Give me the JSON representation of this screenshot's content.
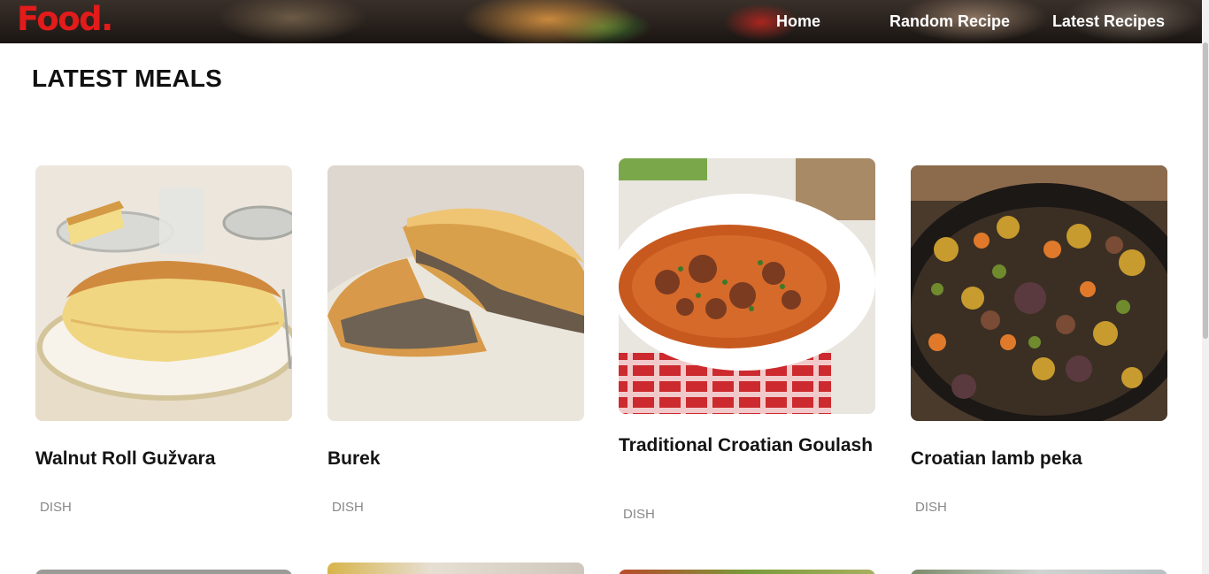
{
  "header": {
    "logo": "Food.",
    "nav": [
      {
        "label": "Home"
      },
      {
        "label": "Random Recipe"
      },
      {
        "label": "Latest Recipes"
      }
    ]
  },
  "main": {
    "section_title": "LATEST MEALS",
    "meals": [
      {
        "title": "Walnut Roll Gužvara",
        "category": "DISH"
      },
      {
        "title": "Burek",
        "category": "DISH"
      },
      {
        "title": "Traditional Croatian Goulash",
        "category": "DISH"
      },
      {
        "title": "Croatian lamb peka",
        "category": "DISH"
      }
    ]
  },
  "colors": {
    "logo": "#e21b1b",
    "nav_text": "#ffffff",
    "title": "#141414",
    "category": "#888888"
  }
}
